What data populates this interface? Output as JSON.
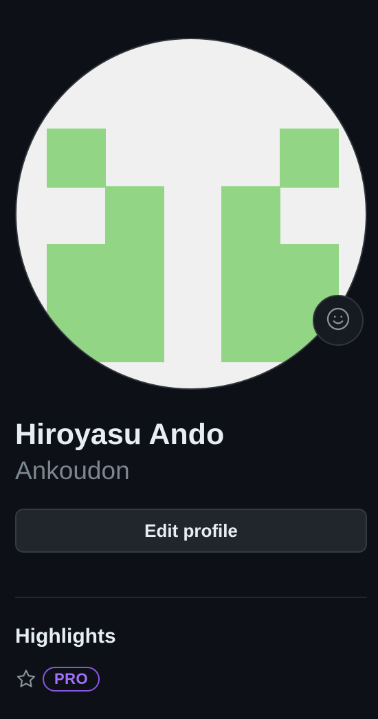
{
  "profile": {
    "full_name": "Hiroyasu Ando",
    "username": "Ankoudon",
    "edit_button_label": "Edit profile",
    "status_icon": "smiley-icon"
  },
  "highlights": {
    "title": "Highlights",
    "items": [
      {
        "icon": "star-icon",
        "badge": "PRO"
      }
    ]
  },
  "colors": {
    "background": "#0d1117",
    "avatar_background": "#f0f0f0",
    "identicon_green": "#92d685",
    "pro_badge": "#a371f7",
    "muted_text": "#7d8590"
  }
}
